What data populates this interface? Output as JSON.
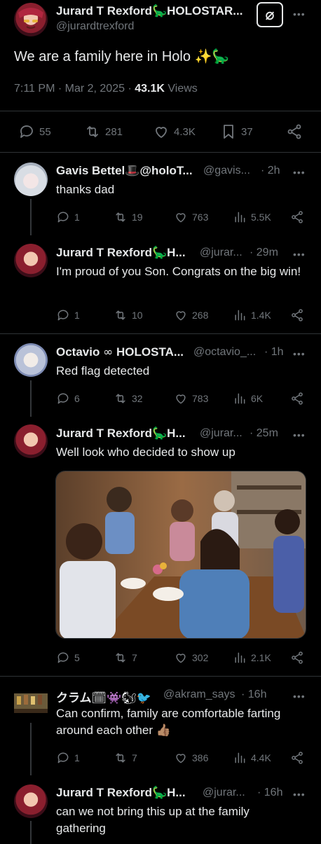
{
  "main_post": {
    "name": "Jurard T Rexford",
    "name_emoji": "🦕",
    "name_suffix": "HOLOSTAR...",
    "handle": "@jurardtrexford",
    "subscribe_glyph": "⌀",
    "text": "We are a family here in Holo ✨🦕",
    "time": "7:11 PM · Mar 2, 2025 ·",
    "views_count": "43.1K",
    "views_label": "Views",
    "replies": "55",
    "reposts": "281",
    "likes": "4.3K",
    "bookmarks": "37"
  },
  "replies": [
    {
      "name": "Gavis Bettel",
      "name_emoji": "🎩",
      "name_suffix": "@holoT...",
      "handle": "@gavis...",
      "time": "· 2h",
      "text": "thanks dad",
      "replies": "1",
      "reposts": "19",
      "likes": "763",
      "views": "5.5K",
      "repost_color": "#71767b"
    },
    {
      "name": "Jurard T Rexford",
      "name_emoji": "🦕",
      "name_suffix": "H...",
      "handle": "@jurar...",
      "time": "· 29m",
      "text": "I'm proud of you Son. Congrats on the big win!",
      "replies": "1",
      "reposts": "10",
      "likes": "268",
      "views": "1.4K",
      "repost_color": "#71767b"
    },
    {
      "name": "Octavio",
      "name_emoji": "∞",
      "name_suffix": "HOLOSTA...",
      "handle": "@octavio_...",
      "time": "· 1h",
      "text": "Red flag detected",
      "replies": "6",
      "reposts": "32",
      "likes": "783",
      "views": "6K",
      "repost_color": "#71767b"
    },
    {
      "name": "Jurard T Rexford",
      "name_emoji": "🦕",
      "name_suffix": "H...",
      "handle": "@jurar...",
      "time": "· 25m",
      "text": "Well look who decided to show up",
      "replies": "5",
      "reposts": "7",
      "likes": "302",
      "views": "2.1K",
      "repost_color": "#71767b"
    },
    {
      "name": "クラム",
      "name_emoji": "🗓👾🐿🐦",
      "name_suffix": "",
      "handle": "@akram_says",
      "time": "· 16h",
      "text": "Can confirm, family are comfortable farting around each other 👍🏽",
      "replies": "1",
      "reposts": "7",
      "likes": "386",
      "views": "4.4K",
      "repost_color": "#71767b"
    },
    {
      "name": "Jurard T Rexford",
      "name_emoji": "🦕",
      "name_suffix": "H...",
      "handle": "@jurar...",
      "time": "· 16h",
      "text": "can we not bring this up at the family gathering"
    }
  ],
  "colors": {
    "background": "#000000",
    "text": "#e7e9ea",
    "muted": "#71767b",
    "divider": "#2f3336"
  },
  "icons": [
    "reply-icon",
    "repost-icon",
    "like-icon",
    "views-icon",
    "bookmark-icon",
    "share-icon",
    "more-icon"
  ]
}
